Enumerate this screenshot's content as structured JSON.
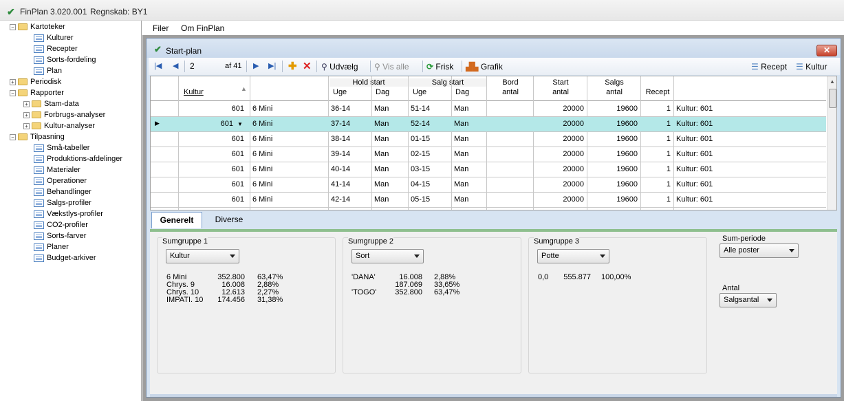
{
  "app": {
    "title": "FinPlan 3.020.001",
    "regnskab": "Regnskab: BY1"
  },
  "menu": {
    "filer": "Filer",
    "om": "Om FinPlan"
  },
  "tree": [
    {
      "label": "Kartoteker",
      "type": "folder",
      "expander": "minus",
      "level": 0
    },
    {
      "label": "Kulturer",
      "type": "doc",
      "level": 1
    },
    {
      "label": "Recepter",
      "type": "doc",
      "level": 1
    },
    {
      "label": "Sorts-fordeling",
      "type": "doc",
      "level": 1
    },
    {
      "label": "Plan",
      "type": "doc",
      "level": 1
    },
    {
      "label": "Periodisk",
      "type": "folder",
      "expander": "plus",
      "level": 0
    },
    {
      "label": "Rapporter",
      "type": "folder",
      "expander": "minus",
      "level": 0
    },
    {
      "label": "Stam-data",
      "type": "folder",
      "expander": "plus",
      "level": 1
    },
    {
      "label": "Forbrugs-analyser",
      "type": "folder",
      "expander": "plus",
      "level": 1
    },
    {
      "label": "Kultur-analyser",
      "type": "folder",
      "expander": "plus",
      "level": 1
    },
    {
      "label": "Tilpasning",
      "type": "folder",
      "expander": "minus",
      "level": 0
    },
    {
      "label": "Små-tabeller",
      "type": "doc",
      "level": 1
    },
    {
      "label": "Produktions-afdelinger",
      "type": "doc",
      "level": 1
    },
    {
      "label": "Materialer",
      "type": "doc",
      "level": 1
    },
    {
      "label": "Operationer",
      "type": "doc",
      "level": 1
    },
    {
      "label": "Behandlinger",
      "type": "doc",
      "level": 1
    },
    {
      "label": "Salgs-profiler",
      "type": "doc",
      "level": 1
    },
    {
      "label": "Vækstlys-profiler",
      "type": "doc",
      "level": 1
    },
    {
      "label": "CO2-profiler",
      "type": "doc",
      "level": 1
    },
    {
      "label": "Sorts-farver",
      "type": "doc",
      "level": 1
    },
    {
      "label": "Planer",
      "type": "doc",
      "level": 1
    },
    {
      "label": "Budget-arkiver",
      "type": "doc",
      "level": 1
    }
  ],
  "window": {
    "title": "Start-plan",
    "close": "✕"
  },
  "toolbar": {
    "position": "2",
    "of": "af 41",
    "udvaelg": "Udvælg",
    "vis_alle": "Vis alle",
    "frisk": "Frisk",
    "grafik": "Grafik",
    "recept": "Recept",
    "kultur": "Kultur"
  },
  "grid": {
    "headers": {
      "kultur": "Kultur",
      "hold_start": "Hold start",
      "salg_start": "Salg start",
      "uge": "Uge",
      "dag": "Dag",
      "bord": "Bord",
      "bord2": "antal",
      "start": "Start",
      "start2": "antal",
      "salgs": "Salgs",
      "salgs2": "antal",
      "recept": "Recept"
    },
    "rows": [
      {
        "kultur": "601",
        "sort": "6 Mini",
        "hold_uge": "36-14",
        "hold_dag": "Man",
        "salg_uge": "51-14",
        "salg_dag": "Man",
        "bord": "",
        "start": "20000",
        "salgs": "19600",
        "recept": "1",
        "info": "Kultur: 601",
        "selected": false
      },
      {
        "kultur": "601",
        "sort": "6 Mini",
        "hold_uge": "37-14",
        "hold_dag": "Man",
        "salg_uge": "52-14",
        "salg_dag": "Man",
        "bord": "",
        "start": "20000",
        "salgs": "19600",
        "recept": "1",
        "info": "Kultur: 601",
        "selected": true
      },
      {
        "kultur": "601",
        "sort": "6 Mini",
        "hold_uge": "38-14",
        "hold_dag": "Man",
        "salg_uge": "01-15",
        "salg_dag": "Man",
        "bord": "",
        "start": "20000",
        "salgs": "19600",
        "recept": "1",
        "info": "Kultur: 601",
        "selected": false
      },
      {
        "kultur": "601",
        "sort": "6 Mini",
        "hold_uge": "39-14",
        "hold_dag": "Man",
        "salg_uge": "02-15",
        "salg_dag": "Man",
        "bord": "",
        "start": "20000",
        "salgs": "19600",
        "recept": "1",
        "info": "Kultur: 601",
        "selected": false
      },
      {
        "kultur": "601",
        "sort": "6 Mini",
        "hold_uge": "40-14",
        "hold_dag": "Man",
        "salg_uge": "03-15",
        "salg_dag": "Man",
        "bord": "",
        "start": "20000",
        "salgs": "19600",
        "recept": "1",
        "info": "Kultur: 601",
        "selected": false
      },
      {
        "kultur": "601",
        "sort": "6 Mini",
        "hold_uge": "41-14",
        "hold_dag": "Man",
        "salg_uge": "04-15",
        "salg_dag": "Man",
        "bord": "",
        "start": "20000",
        "salgs": "19600",
        "recept": "1",
        "info": "Kultur: 601",
        "selected": false
      },
      {
        "kultur": "601",
        "sort": "6 Mini",
        "hold_uge": "42-14",
        "hold_dag": "Man",
        "salg_uge": "05-15",
        "salg_dag": "Man",
        "bord": "",
        "start": "20000",
        "salgs": "19600",
        "recept": "1",
        "info": "Kultur: 601",
        "selected": false
      }
    ]
  },
  "tabs": {
    "generelt": "Generelt",
    "diverse": "Diverse"
  },
  "groups": {
    "g1": {
      "label": "Sumgruppe 1",
      "combo": "Kultur",
      "rows": [
        [
          "6 Mini",
          "352.800",
          "63,47%"
        ],
        [
          "Chrys. 9",
          "16.008",
          "2,88%"
        ],
        [
          "Chrys. 10",
          "12.613",
          "2,27%"
        ],
        [
          "IMPATI. 10",
          "174.456",
          "31,38%"
        ]
      ]
    },
    "g2": {
      "label": "Sumgruppe 2",
      "combo": "Sort",
      "rows": [
        [
          "'DANA'",
          "16.008",
          "2,88%"
        ],
        [
          "",
          "187.069",
          "33,65%"
        ],
        [
          "'TOGO'",
          "352.800",
          "63,47%"
        ]
      ]
    },
    "g3": {
      "label": "Sumgruppe 3",
      "combo": "Potte",
      "rows": [
        [
          "0,0",
          "555.877",
          "100,00%"
        ]
      ]
    }
  },
  "sum_periode": {
    "label": "Sum-periode",
    "value": "Alle poster"
  },
  "antal": {
    "label": "Antal",
    "value": "Salgsantal"
  }
}
